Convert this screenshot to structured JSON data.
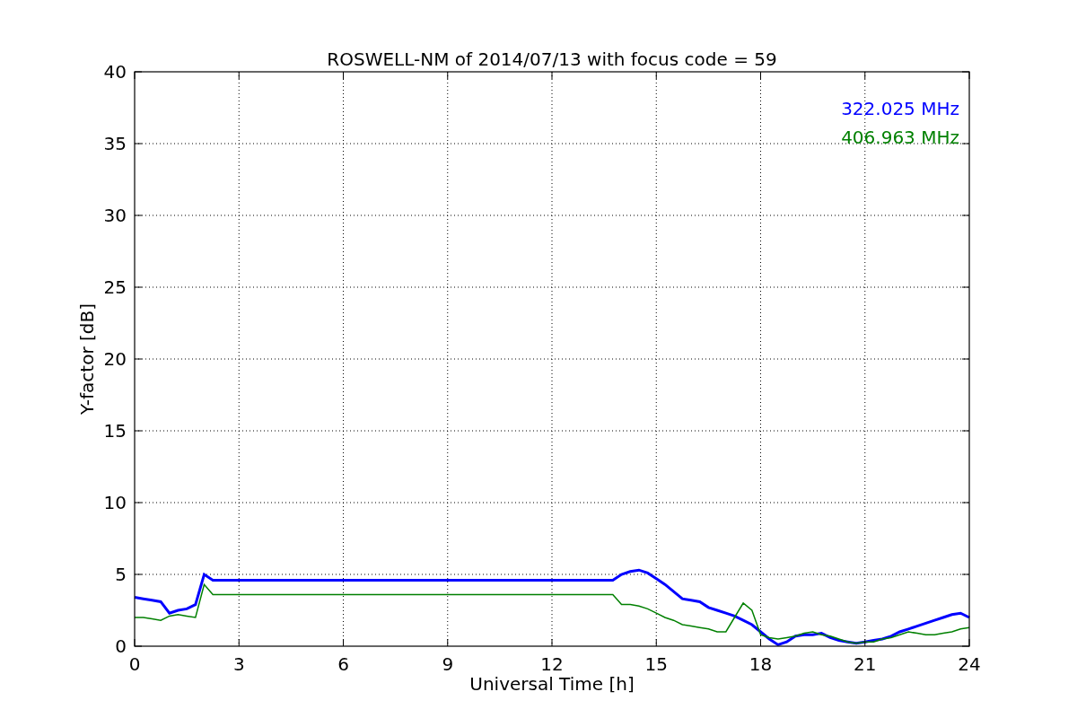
{
  "chart_data": {
    "type": "line",
    "title": "ROSWELL-NM of 2014/07/13 with focus code = 59",
    "xlabel": "Universal Time [h]",
    "ylabel": "Y-factor [dB]",
    "x": [
      0,
      0.25,
      0.5,
      0.75,
      1,
      1.25,
      1.5,
      1.75,
      2,
      2.25,
      13.75,
      14,
      14.25,
      14.5,
      14.75,
      15,
      15.25,
      15.5,
      15.75,
      16,
      16.25,
      16.5,
      16.75,
      17,
      17.25,
      17.5,
      17.75,
      18,
      18.25,
      18.5,
      18.75,
      19,
      19.25,
      19.5,
      19.75,
      20,
      20.25,
      20.5,
      20.75,
      21,
      21.25,
      21.5,
      21.75,
      22,
      22.25,
      22.5,
      22.75,
      23,
      23.25,
      23.5,
      23.75,
      24
    ],
    "series": [
      {
        "name": "322.025 MHz",
        "color": "#0000ff",
        "values": [
          3.4,
          3.3,
          3.2,
          3.1,
          2.3,
          2.5,
          2.6,
          2.9,
          5.0,
          4.6,
          4.6,
          5.0,
          5.2,
          5.3,
          5.1,
          4.7,
          4.3,
          3.8,
          3.3,
          3.2,
          3.1,
          2.7,
          2.5,
          2.3,
          2.1,
          1.8,
          1.5,
          1.0,
          0.5,
          0.1,
          0.3,
          0.7,
          0.8,
          0.8,
          0.9,
          0.6,
          0.4,
          0.3,
          0.2,
          0.3,
          0.4,
          0.5,
          0.7,
          1.0,
          1.2,
          1.4,
          1.6,
          1.8,
          2.0,
          2.2,
          2.3,
          2.0
        ]
      },
      {
        "name": "406.963 MHz",
        "color": "#008000",
        "values": [
          2.0,
          2.0,
          1.9,
          1.8,
          2.1,
          2.2,
          2.1,
          2.0,
          4.3,
          3.6,
          3.6,
          2.9,
          2.9,
          2.8,
          2.6,
          2.3,
          2.0,
          1.8,
          1.5,
          1.4,
          1.3,
          1.2,
          1.0,
          1.0,
          2.0,
          3.0,
          2.5,
          0.8,
          0.6,
          0.5,
          0.6,
          0.7,
          0.9,
          1.0,
          0.8,
          0.7,
          0.5,
          0.3,
          0.2,
          0.3,
          0.3,
          0.5,
          0.6,
          0.8,
          1.0,
          0.9,
          0.8,
          0.8,
          0.9,
          1.0,
          1.2,
          1.3
        ]
      }
    ],
    "xlim": [
      0,
      24
    ],
    "ylim": [
      0,
      40
    ],
    "xticks": [
      0,
      3,
      6,
      9,
      12,
      15,
      18,
      21,
      24
    ],
    "yticks": [
      0,
      5,
      10,
      15,
      20,
      25,
      30,
      35,
      40
    ],
    "grid": true
  }
}
